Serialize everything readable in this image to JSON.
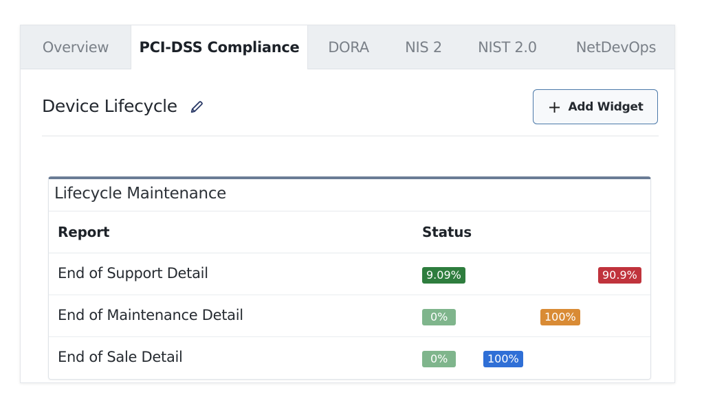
{
  "tabs": [
    {
      "label": "Overview",
      "active": false
    },
    {
      "label": "PCI-DSS Compliance",
      "active": true
    },
    {
      "label": "DORA",
      "active": false
    },
    {
      "label": "NIS 2",
      "active": false
    },
    {
      "label": "NIST 2.0",
      "active": false
    },
    {
      "label": "NetDevOps",
      "active": false
    }
  ],
  "header": {
    "title": "Device Lifecycle",
    "edit_icon": "pencil-icon",
    "add_widget_label": "Add Widget",
    "add_widget_icon": "plus-icon"
  },
  "widget": {
    "title": "Lifecycle Maintenance",
    "columns": {
      "report": "Report",
      "status": "Status"
    },
    "rows": [
      {
        "report": "End of Support Detail",
        "status": [
          {
            "label": "9.09%",
            "color": "#2e7d3e"
          },
          {
            "label": "90.9%",
            "color": "#c0333c"
          }
        ]
      },
      {
        "report": "End of Maintenance Detail",
        "status": [
          {
            "label": "0%",
            "color": "#7fb58c"
          },
          {
            "label": "100%",
            "color": "#d98b35"
          }
        ]
      },
      {
        "report": "End of Sale Detail",
        "status": [
          {
            "label": "0%",
            "color": "#7fb58c"
          },
          {
            "label": "100%",
            "color": "#2f6fd6"
          }
        ]
      }
    ]
  }
}
